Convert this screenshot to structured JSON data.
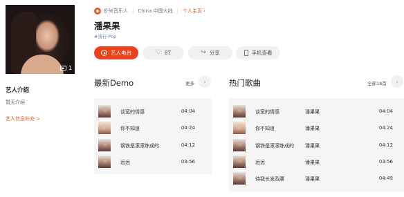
{
  "meta": {
    "site": "虾米音乐人",
    "region": "China 中国大陆",
    "homepage_link": "个人主页"
  },
  "artist": {
    "name": "潘果果",
    "tags": "#流行 Pop",
    "photo_count": "1"
  },
  "sidebar": {
    "intro_heading": "艺人介绍",
    "intro_text": "暂无介绍",
    "supplement_link": "艺人信息补充 >"
  },
  "actions": {
    "radio_label": "艺人电台",
    "like_count": "87",
    "share_label": "分享",
    "phone_label": "手机查看"
  },
  "demo": {
    "title": "最新Demo",
    "more_label": "更多",
    "songs": [
      {
        "title": "谈宽的情感",
        "duration": "04:04"
      },
      {
        "title": "你不知道",
        "duration": "04:24"
      },
      {
        "title": "钢铁是滚滚练成的",
        "duration": "04:12"
      },
      {
        "title": "远远",
        "duration": "03:56"
      }
    ]
  },
  "hot": {
    "title": "热门歌曲",
    "more_label": "全部18首",
    "songs": [
      {
        "title": "谈宽的情感",
        "artist": "潘果果",
        "duration": "04:04"
      },
      {
        "title": "你不知道",
        "artist": "潘果果",
        "duration": "04:24"
      },
      {
        "title": "钢铁是滚滚练成的",
        "artist": "潘果果",
        "duration": "04:12"
      },
      {
        "title": "远远",
        "artist": "潘果果",
        "duration": "03:56"
      },
      {
        "title": "待我长发及腰",
        "artist": "潘果果",
        "duration": "04:49"
      }
    ]
  },
  "colors": {
    "accent": "#e8431c",
    "link_orange": "#e4581f",
    "tag_blue": "#5a7bbf"
  }
}
